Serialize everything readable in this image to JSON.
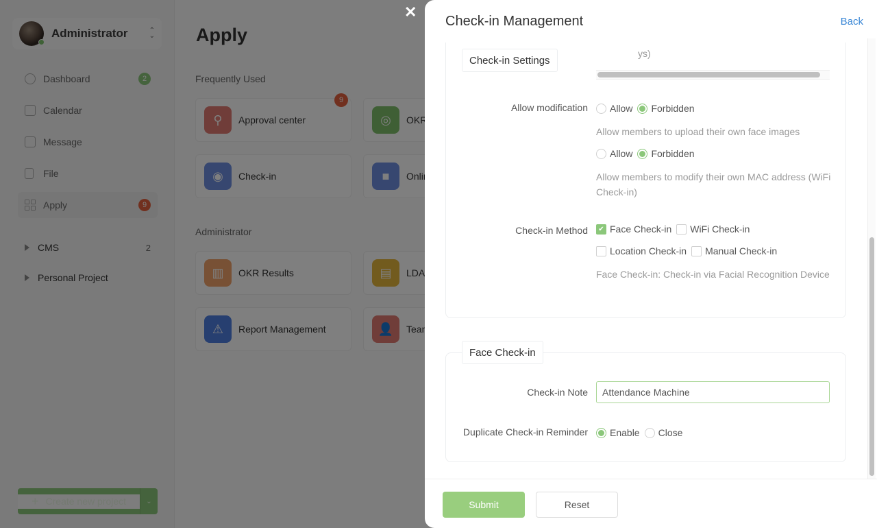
{
  "sidebar": {
    "user": {
      "name": "Administrator",
      "online": true
    },
    "nav": [
      {
        "label": "Dashboard",
        "icon": "dashboard-icon",
        "badge": "2",
        "badge_color": "#8bc77a"
      },
      {
        "label": "Calendar",
        "icon": "calendar-icon",
        "badge": null
      },
      {
        "label": "Message",
        "icon": "message-icon",
        "badge": null
      },
      {
        "label": "File",
        "icon": "file-icon",
        "badge": null
      },
      {
        "label": "Apply",
        "icon": "grid-icon",
        "badge": "9",
        "badge_color": "#e2603e",
        "active": true
      }
    ],
    "projects": [
      {
        "label": "CMS",
        "count": "2"
      },
      {
        "label": "Personal Project",
        "count": ""
      }
    ],
    "create_button": {
      "label": "Create new project",
      "plus": "+",
      "caret": "⌄"
    }
  },
  "main": {
    "title": "Apply",
    "sections": [
      {
        "label": "Frequently Used",
        "apps": [
          {
            "label": "Approval center",
            "icon": "stamp-icon",
            "color": "#e07b72",
            "badge": "9"
          },
          {
            "label": "OKR",
            "icon": "target-icon",
            "color": "#7fbf6a"
          },
          {
            "label": "Check-in",
            "icon": "location-pin-icon",
            "color": "#6f8fe0"
          },
          {
            "label": "Onlin",
            "icon": "video-icon",
            "color": "#6f8fe0"
          }
        ]
      },
      {
        "label": "Administrator",
        "apps": [
          {
            "label": "OKR Results",
            "icon": "bar-chart-icon",
            "color": "#f0a36a"
          },
          {
            "label": "LDA",
            "icon": "contact-book-icon",
            "color": "#e5b63d"
          },
          {
            "label": "Report Management",
            "icon": "warning-icon",
            "color": "#4f7fe0"
          },
          {
            "label": "Tean",
            "icon": "team-icon",
            "color": "#e07b72"
          }
        ]
      }
    ]
  },
  "overlay": {
    "close_symbol": "✕"
  },
  "drawer": {
    "title": "Check-in Management",
    "back_label": "Back",
    "check_in_settings": {
      "legend": "Check-in Settings",
      "truncated_hint_tail": "ys)",
      "allow_modification": {
        "label": "Allow modification",
        "face_images": {
          "options": [
            "Allow",
            "Forbidden"
          ],
          "selected": "Forbidden",
          "hint": "Allow members to upload their own face images"
        },
        "mac_address": {
          "options": [
            "Allow",
            "Forbidden"
          ],
          "selected": "Forbidden",
          "hint": "Allow members to modify their own MAC address (WiFi Check-in)"
        }
      },
      "check_in_method": {
        "label": "Check-in Method",
        "options": [
          {
            "label": "Face Check-in",
            "checked": true
          },
          {
            "label": "WiFi Check-in",
            "checked": false
          },
          {
            "label": "Location Check-in",
            "checked": false
          },
          {
            "label": "Manual Check-in",
            "checked": false
          }
        ],
        "hint": "Face Check-in: Check-in via Facial Recognition Device"
      }
    },
    "face_check_in": {
      "legend": "Face Check-in",
      "note": {
        "label": "Check-in Note",
        "value": "Attendance Machine"
      },
      "duplicate_reminder": {
        "label": "Duplicate Check-in Reminder",
        "options": [
          "Enable",
          "Close"
        ],
        "selected": "Enable"
      }
    },
    "footer": {
      "submit_label": "Submit",
      "reset_label": "Reset"
    }
  },
  "colors": {
    "accent_green": "#8bc77a",
    "link_blue": "#3a87d6",
    "badge_red": "#e2603e"
  }
}
